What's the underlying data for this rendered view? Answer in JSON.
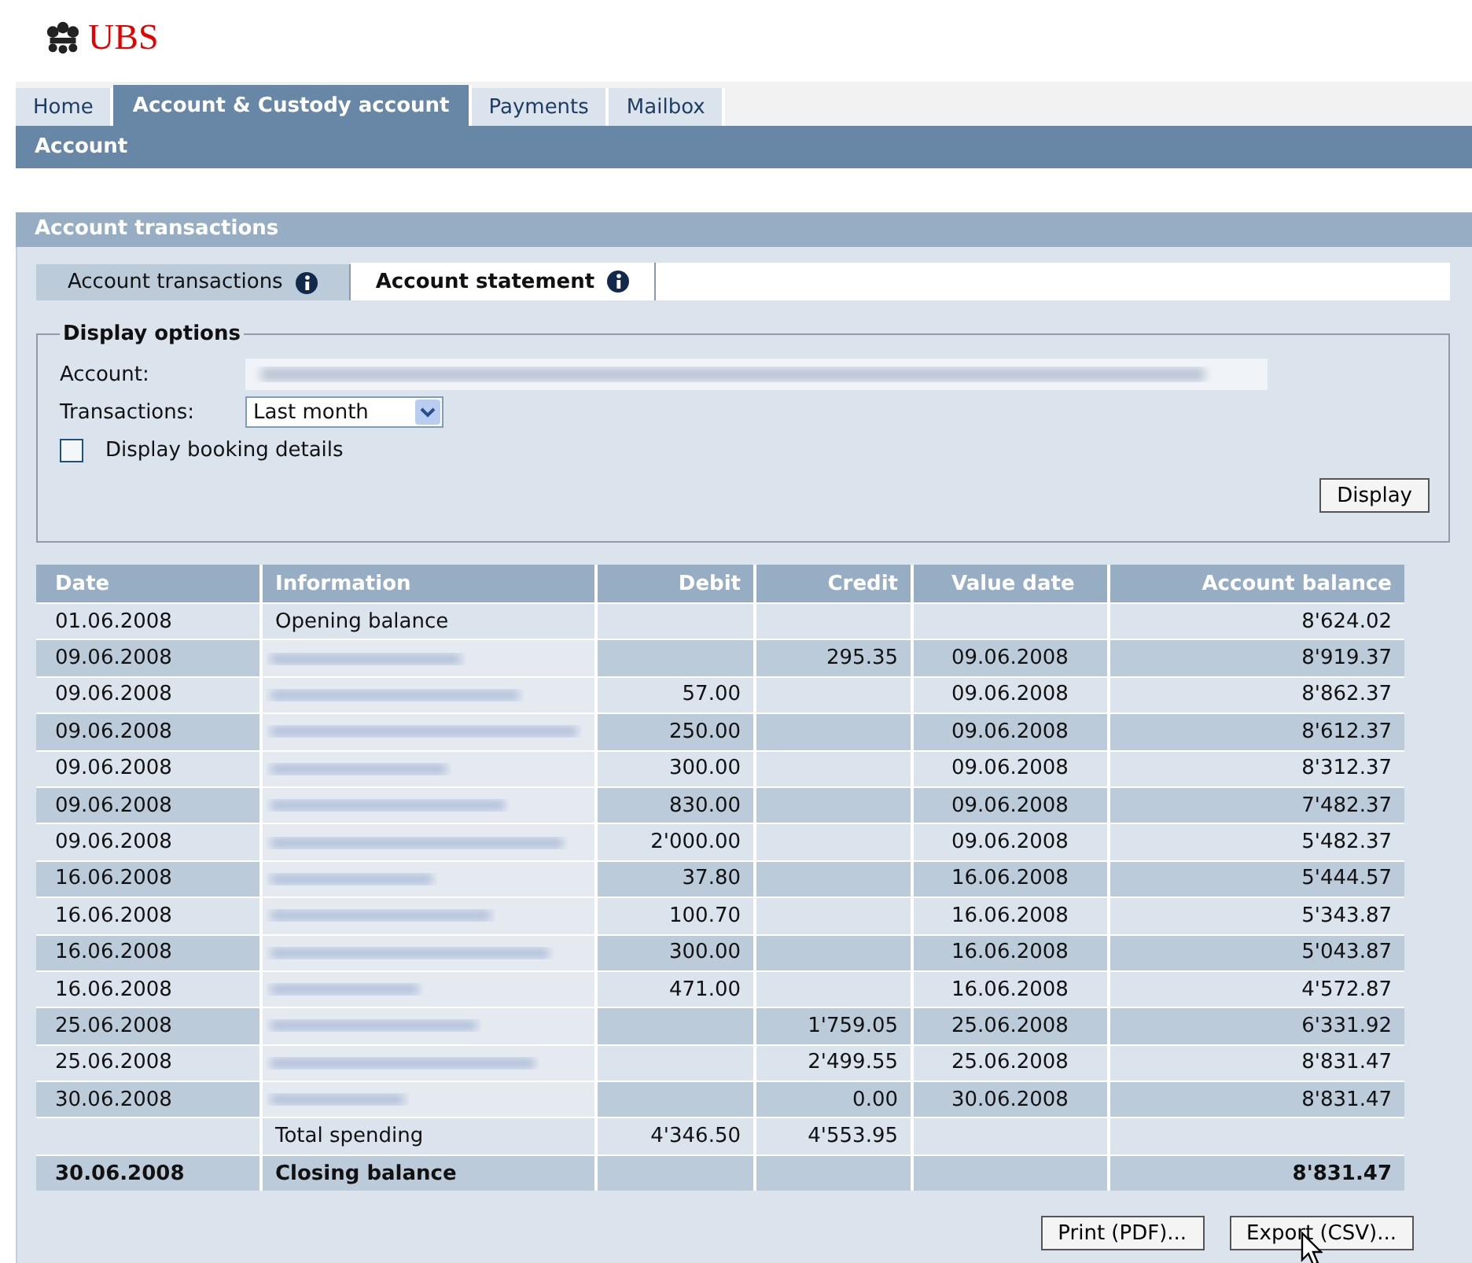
{
  "logo": {
    "text": "UBS"
  },
  "nav_tabs": [
    {
      "label": "Home",
      "selected": false
    },
    {
      "label": "Account & Custody account",
      "selected": true
    },
    {
      "label": "Payments",
      "selected": false
    },
    {
      "label": "Mailbox",
      "selected": false
    }
  ],
  "sub_nav": {
    "label": "Account"
  },
  "panel": {
    "title": "Account transactions"
  },
  "tabs": [
    {
      "label": "Account transactions",
      "selected": false
    },
    {
      "label": "Account statement",
      "selected": true
    }
  ],
  "display_options": {
    "legend": "Display options",
    "account_label": "Account:",
    "transactions_label": "Transactions:",
    "transactions_value": "Last month",
    "booking_details": {
      "label": "Display booking details",
      "checked": false
    },
    "button": "Display"
  },
  "table": {
    "columns": [
      "Date",
      "Information",
      "Debit",
      "Credit",
      "Value date",
      "Account balance"
    ],
    "rows": [
      {
        "kind": "opening",
        "date": "01.06.2008",
        "information": "Opening balance",
        "debit": "",
        "credit": "",
        "value_date": "",
        "balance": "8'624.02"
      },
      {
        "kind": "transaction",
        "date": "09.06.2008",
        "debit": "",
        "credit": "295.35",
        "value_date": "09.06.2008",
        "balance": "8'919.37"
      },
      {
        "kind": "transaction",
        "date": "09.06.2008",
        "debit": "57.00",
        "credit": "",
        "value_date": "09.06.2008",
        "balance": "8'862.37"
      },
      {
        "kind": "transaction",
        "date": "09.06.2008",
        "debit": "250.00",
        "credit": "",
        "value_date": "09.06.2008",
        "balance": "8'612.37"
      },
      {
        "kind": "transaction",
        "date": "09.06.2008",
        "debit": "300.00",
        "credit": "",
        "value_date": "09.06.2008",
        "balance": "8'312.37"
      },
      {
        "kind": "transaction",
        "date": "09.06.2008",
        "debit": "830.00",
        "credit": "",
        "value_date": "09.06.2008",
        "balance": "7'482.37"
      },
      {
        "kind": "transaction",
        "date": "09.06.2008",
        "debit": "2'000.00",
        "credit": "",
        "value_date": "09.06.2008",
        "balance": "5'482.37"
      },
      {
        "kind": "transaction",
        "date": "16.06.2008",
        "debit": "37.80",
        "credit": "",
        "value_date": "16.06.2008",
        "balance": "5'444.57"
      },
      {
        "kind": "transaction",
        "date": "16.06.2008",
        "debit": "100.70",
        "credit": "",
        "value_date": "16.06.2008",
        "balance": "5'343.87"
      },
      {
        "kind": "transaction",
        "date": "16.06.2008",
        "debit": "300.00",
        "credit": "",
        "value_date": "16.06.2008",
        "balance": "5'043.87"
      },
      {
        "kind": "transaction",
        "date": "16.06.2008",
        "debit": "471.00",
        "credit": "",
        "value_date": "16.06.2008",
        "balance": "4'572.87"
      },
      {
        "kind": "transaction",
        "date": "25.06.2008",
        "debit": "",
        "credit": "1'759.05",
        "value_date": "25.06.2008",
        "balance": "6'331.92"
      },
      {
        "kind": "transaction",
        "date": "25.06.2008",
        "debit": "",
        "credit": "2'499.55",
        "value_date": "25.06.2008",
        "balance": "8'831.47"
      },
      {
        "kind": "transaction",
        "date": "30.06.2008",
        "debit": "",
        "credit": "0.00",
        "value_date": "30.06.2008",
        "balance": "8'831.47"
      },
      {
        "kind": "total",
        "date": "",
        "information": "Total spending",
        "debit": "4'346.50",
        "credit": "4'553.95",
        "value_date": "",
        "balance": ""
      },
      {
        "kind": "closing",
        "date": "30.06.2008",
        "information": "Closing balance",
        "debit": "",
        "credit": "",
        "value_date": "",
        "balance": "8'831.47"
      }
    ]
  },
  "buttons": [
    "Print (PDF)...",
    "Export (CSV)..."
  ]
}
